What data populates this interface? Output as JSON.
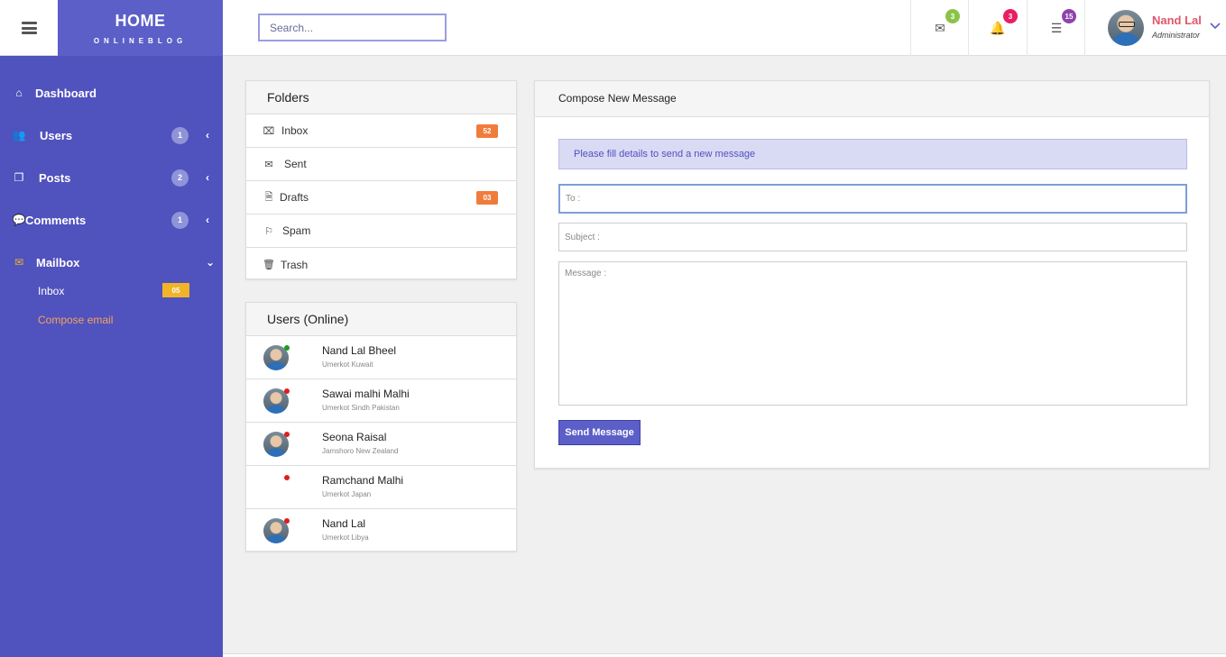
{
  "header": {
    "brand_title": "HOME",
    "brand_subtitle": "ONLINEBLOG",
    "search_placeholder": "Search...",
    "icons": [
      {
        "name": "mail-icon",
        "glyph": "✉",
        "count": "3",
        "color": "#8bc34a"
      },
      {
        "name": "bell-icon",
        "glyph": "🔔",
        "count": "3",
        "color": "#e91e63"
      },
      {
        "name": "tasks-icon",
        "glyph": "☰",
        "count": "15",
        "color": "#8e44ad"
      }
    ],
    "profile_name": "Nand Lal",
    "profile_role": "Administrator"
  },
  "sidebar": {
    "items": [
      {
        "label": "Dashboard",
        "icon": "home-icon",
        "glyph": "⌂",
        "badge": null,
        "arrow": null
      },
      {
        "label": "Users",
        "icon": "users-icon",
        "glyph": "👥",
        "badge": "1",
        "arrow": "‹"
      },
      {
        "label": "Posts",
        "icon": "posts-icon",
        "glyph": "❐",
        "badge": "2",
        "arrow": "‹"
      },
      {
        "label": "Comments",
        "icon": "comments-icon",
        "glyph": "💬",
        "badge": "1",
        "arrow": "‹"
      },
      {
        "label": "Mailbox",
        "icon": "envelope-icon",
        "glyph": "✉",
        "badge": null,
        "arrow": "⌄"
      }
    ],
    "sub_items": [
      {
        "label": "Inbox",
        "badge": "05",
        "color": "#ffffff"
      },
      {
        "label": "Compose email",
        "badge": null,
        "color": "#f5a25d"
      }
    ]
  },
  "folders": {
    "title": "Folders",
    "items": [
      {
        "label": "Inbox",
        "icon": "inbox-icon",
        "glyph": "⌧",
        "badge": "52"
      },
      {
        "label": "Sent",
        "icon": "envelope-icon",
        "glyph": "✉",
        "badge": null
      },
      {
        "label": "Drafts",
        "icon": "document-icon",
        "glyph": "🗎",
        "badge": "03"
      },
      {
        "label": "Spam",
        "icon": "flag-icon",
        "glyph": "⚐",
        "badge": null
      },
      {
        "label": "Trash",
        "icon": "trash-icon",
        "glyph": "🗑",
        "badge": null
      }
    ]
  },
  "users_online": {
    "title": "Users (Online)",
    "users": [
      {
        "name": "Nand Lal Bheel",
        "location": "Umerkot Kuwait",
        "status_color": "#1a9e1a",
        "has_avatar": true
      },
      {
        "name": "Sawai malhi Malhi",
        "location": "Umerkot Sindh Pakistan",
        "status_color": "#e01e1e",
        "has_avatar": true
      },
      {
        "name": "Seona Raisal",
        "location": "Jamshoro New Zealand",
        "status_color": "#e01e1e",
        "has_avatar": true
      },
      {
        "name": "Ramchand Malhi",
        "location": "Umerkot Japan",
        "status_color": "#e01e1e",
        "has_avatar": false
      },
      {
        "name": "Nand Lal",
        "location": "Umerkot Libya",
        "status_color": "#e01e1e",
        "has_avatar": true
      }
    ]
  },
  "compose": {
    "title": "Compose New Message",
    "alert": "Please fill details to send a new message",
    "to_placeholder": "To :",
    "subject_placeholder": "Subject :",
    "message_placeholder": "Message :",
    "send_label": "Send Message"
  }
}
